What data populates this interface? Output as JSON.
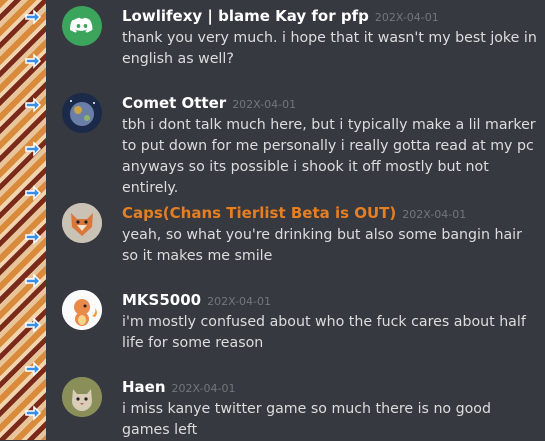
{
  "colors": {
    "background": "#36393f",
    "username": "#ffffff",
    "username_highlight": "#e67e22",
    "timestamp": "#72767d",
    "message_text": "#dcddde"
  },
  "messages": [
    {
      "username": "Lowlifexy | blame Kay for pfp",
      "timestamp": "202X-04-01",
      "avatar_icon": "discord-logo-icon",
      "text": "thank you very much. i hope that it wasn't my best joke in english as well?"
    },
    {
      "username": "Comet Otter",
      "timestamp": "202X-04-01",
      "avatar_icon": "planet-avatar",
      "text": "tbh i dont talk much here, but i typically make a lil marker to put down for me personally i really gotta read at my pc anyways so its possible i shook it off mostly but not entirely."
    },
    {
      "username": "Caps(Chans Tierlist Beta is OUT)",
      "timestamp": "202X-04-01",
      "avatar_icon": "fox-mask-avatar",
      "text": "yeah, so what you're drinking but also some bangin hair so it makes me smile"
    },
    {
      "username": "MKS5000",
      "timestamp": "202X-04-01",
      "avatar_icon": "charmander-avatar",
      "text": "i'm mostly confused about who the fuck cares about half life for some reason"
    },
    {
      "username": "Haen",
      "timestamp": "202X-04-01",
      "avatar_icon": "cat-avatar",
      "text": "i miss kanye twitter game so much there is no good games left"
    }
  ]
}
